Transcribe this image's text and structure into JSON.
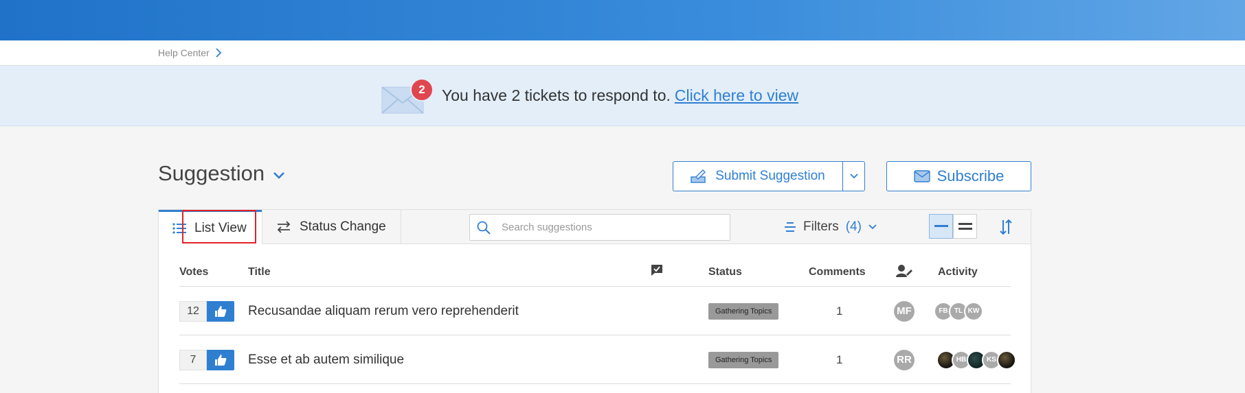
{
  "breadcrumb": {
    "label": "Help Center"
  },
  "banner": {
    "badge_count": "2",
    "message": "You have 2 tickets to respond to.",
    "link_text": "Click here to view"
  },
  "header": {
    "title": "Suggestion",
    "submit_label": "Submit Suggestion",
    "subscribe_label": "Subscribe"
  },
  "toolbar": {
    "tabs": [
      {
        "label": "List View",
        "active": true
      },
      {
        "label": "Status Change",
        "active": false
      }
    ],
    "search_placeholder": "Search suggestions",
    "filters_label": "Filters",
    "filters_count": "(4)"
  },
  "table": {
    "columns": {
      "votes": "Votes",
      "title": "Title",
      "status": "Status",
      "comments": "Comments",
      "activity": "Activity"
    },
    "rows": [
      {
        "votes": "12",
        "title": "Recusandae aliquam rerum vero reprehenderit",
        "status": "Gathering Topics",
        "comments": "1",
        "assignee": "MF",
        "activity": [
          "FB",
          "TL",
          "KW"
        ]
      },
      {
        "votes": "7",
        "title": "Esse et ab autem similique",
        "status": "Gathering Topics",
        "comments": "1",
        "assignee": "RR",
        "activity": [
          "",
          "HB",
          "",
          "KS",
          ""
        ]
      }
    ]
  },
  "colors": {
    "accent": "#2f7fd1",
    "badge_red": "#e0464f",
    "banner_bg": "#e3eef9",
    "status_badge": "#999999"
  }
}
